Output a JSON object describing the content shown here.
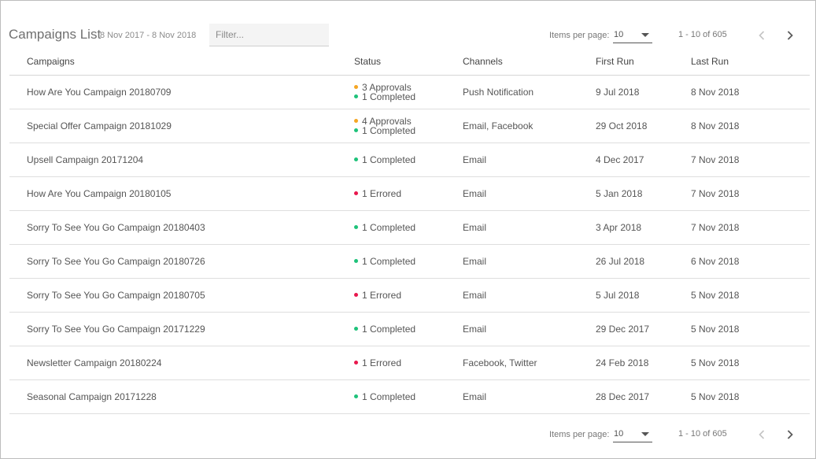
{
  "header": {
    "title": "Campaigns List",
    "date_range": "8 Nov 2017 - 8 Nov 2018",
    "filter_placeholder": "Filter..."
  },
  "pager": {
    "items_per_page_label": "Items per page:",
    "items_per_page_value": "10",
    "range_text": "1 - 10 of 605"
  },
  "columns": [
    "Campaigns",
    "Status",
    "Channels",
    "First Run",
    "Last Run"
  ],
  "colors": {
    "approval": "#f5a623",
    "completed": "#1ec27a",
    "errored": "#e8174d"
  },
  "rows": [
    {
      "name": "How Are You Campaign 20180709",
      "status": [
        {
          "kind": "approval",
          "text": "3 Approvals"
        },
        {
          "kind": "completed",
          "text": "1 Completed"
        }
      ],
      "channels": "Push Notification",
      "first_run": "9 Jul 2018",
      "last_run": "8 Nov 2018"
    },
    {
      "name": "Special Offer Campaign 20181029",
      "status": [
        {
          "kind": "approval",
          "text": "4 Approvals"
        },
        {
          "kind": "completed",
          "text": "1 Completed"
        }
      ],
      "channels": "Email, Facebook",
      "first_run": "29 Oct 2018",
      "last_run": "8 Nov 2018"
    },
    {
      "name": "Upsell Campaign 20171204",
      "status": [
        {
          "kind": "completed",
          "text": "1 Completed"
        }
      ],
      "channels": "Email",
      "first_run": "4 Dec 2017",
      "last_run": "7 Nov 2018"
    },
    {
      "name": "How Are You Campaign 20180105",
      "status": [
        {
          "kind": "errored",
          "text": "1 Errored"
        }
      ],
      "channels": "Email",
      "first_run": "5 Jan 2018",
      "last_run": "7 Nov 2018"
    },
    {
      "name": "Sorry To See You Go Campaign 20180403",
      "status": [
        {
          "kind": "completed",
          "text": "1 Completed"
        }
      ],
      "channels": "Email",
      "first_run": "3 Apr 2018",
      "last_run": "7 Nov 2018"
    },
    {
      "name": "Sorry To See You Go Campaign 20180726",
      "status": [
        {
          "kind": "completed",
          "text": "1 Completed"
        }
      ],
      "channels": "Email",
      "first_run": "26 Jul 2018",
      "last_run": "6 Nov 2018"
    },
    {
      "name": "Sorry To See You Go Campaign 20180705",
      "status": [
        {
          "kind": "errored",
          "text": "1 Errored"
        }
      ],
      "channels": "Email",
      "first_run": "5 Jul 2018",
      "last_run": "5 Nov 2018"
    },
    {
      "name": "Sorry To See You Go Campaign 20171229",
      "status": [
        {
          "kind": "completed",
          "text": "1 Completed"
        }
      ],
      "channels": "Email",
      "first_run": "29 Dec 2017",
      "last_run": "5 Nov 2018"
    },
    {
      "name": "Newsletter Campaign 20180224",
      "status": [
        {
          "kind": "errored",
          "text": "1 Errored"
        }
      ],
      "channels": "Facebook, Twitter",
      "first_run": "24 Feb 2018",
      "last_run": "5 Nov 2018"
    },
    {
      "name": "Seasonal Campaign 20171228",
      "status": [
        {
          "kind": "completed",
          "text": "1 Completed"
        }
      ],
      "channels": "Email",
      "first_run": "28 Dec 2017",
      "last_run": "5 Nov 2018"
    }
  ]
}
